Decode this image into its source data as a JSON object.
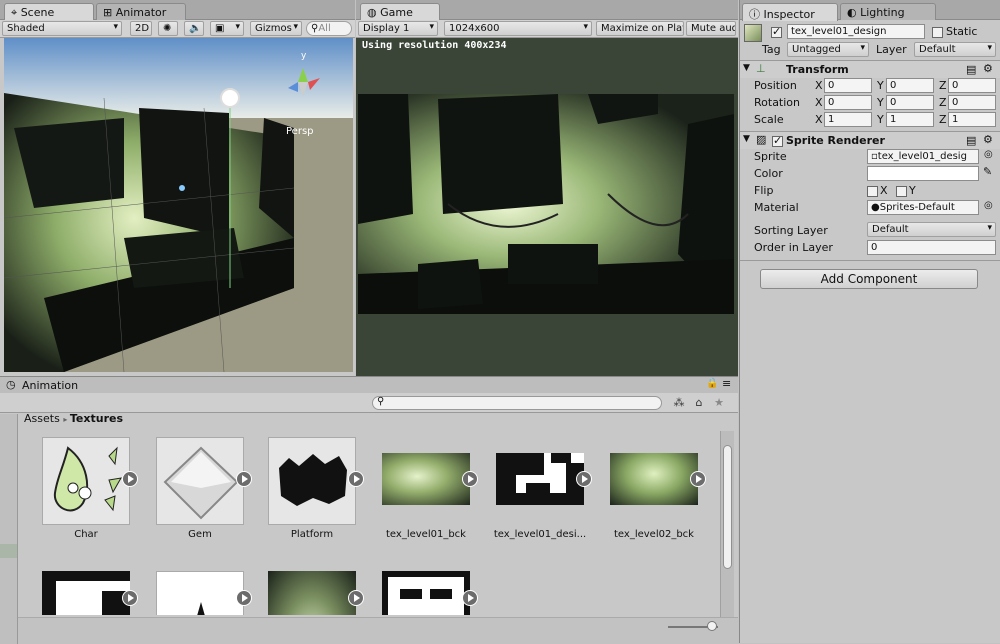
{
  "scene": {
    "tabs": [
      "Scene",
      "Animator"
    ],
    "shading": "Shaded",
    "mode_2d": "2D",
    "gizmos": "Gizmos",
    "search_placeholder": "All",
    "persp_label": "Persp"
  },
  "game": {
    "tab": "Game",
    "display": "Display 1",
    "resolution": "1024x600",
    "maximize": "Maximize on Play",
    "mute": "Mute aud",
    "overlay": "Using resolution 400x234"
  },
  "inspector": {
    "tabs": [
      "Inspector",
      "Lighting"
    ],
    "object_name": "tex_level01_design",
    "static_label": "Static",
    "tag_label": "Tag",
    "tag_value": "Untagged",
    "layer_label": "Layer",
    "layer_value": "Default",
    "transform": {
      "title": "Transform",
      "rows": [
        {
          "label": "Position",
          "x": "0",
          "y": "0",
          "z": "0"
        },
        {
          "label": "Rotation",
          "x": "0",
          "y": "0",
          "z": "0"
        },
        {
          "label": "Scale",
          "x": "1",
          "y": "1",
          "z": "1"
        }
      ],
      "axis": {
        "x": "X",
        "y": "Y",
        "z": "Z"
      }
    },
    "sprite_renderer": {
      "title": "Sprite Renderer",
      "sprite_label": "Sprite",
      "sprite_value": "tex_level01_desig",
      "color_label": "Color",
      "flip_label": "Flip",
      "flip_x": "X",
      "flip_y": "Y",
      "material_label": "Material",
      "material_value": "Sprites-Default",
      "sorting_label": "Sorting Layer",
      "sorting_value": "Default",
      "order_label": "Order in Layer",
      "order_value": "0"
    },
    "add_component": "Add Component"
  },
  "project": {
    "tab": "Animation",
    "breadcrumb_root": "Assets",
    "breadcrumb_current": "Textures",
    "assets": [
      {
        "name": "Char"
      },
      {
        "name": "Gem"
      },
      {
        "name": "Platform"
      },
      {
        "name": "tex_level01_bck"
      },
      {
        "name": "tex_level01_desi..."
      },
      {
        "name": "tex_level02_bck"
      }
    ]
  },
  "colors": {
    "game_bg": "#3a4538",
    "scene_sky": "#c0d0e0",
    "ground": "#9c9a84"
  }
}
